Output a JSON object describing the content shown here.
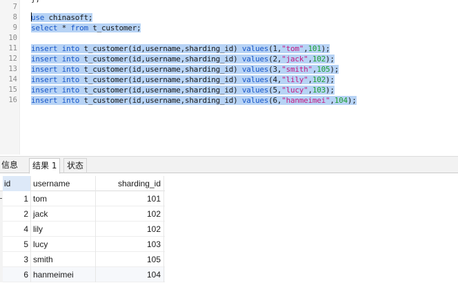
{
  "editor": {
    "top_fragment": "};",
    "lines": [
      {
        "no": "7",
        "tokens": []
      },
      {
        "no": "8",
        "tokens": [
          {
            "t": "kw",
            "v": "use"
          },
          {
            "t": "pl",
            "v": " chinasoft;"
          }
        ],
        "selected": true
      },
      {
        "no": "9",
        "tokens": [
          {
            "t": "kw",
            "v": "select"
          },
          {
            "t": "pl",
            "v": " * "
          },
          {
            "t": "kw",
            "v": "from"
          },
          {
            "t": "pl",
            "v": " t_customer;"
          }
        ],
        "selected": true
      },
      {
        "no": "10",
        "tokens": []
      },
      {
        "no": "11",
        "tokens": [
          {
            "t": "kw",
            "v": "insert into"
          },
          {
            "t": "pl",
            "v": " t_customer(id,username,sharding_id) "
          },
          {
            "t": "kw",
            "v": "values"
          },
          {
            "t": "pl",
            "v": "(1,"
          },
          {
            "t": "str",
            "v": "\"tom\""
          },
          {
            "t": "pl",
            "v": ","
          },
          {
            "t": "num",
            "v": "101"
          },
          {
            "t": "pl",
            "v": ");"
          }
        ],
        "selected": true
      },
      {
        "no": "12",
        "tokens": [
          {
            "t": "kw",
            "v": "insert into"
          },
          {
            "t": "pl",
            "v": " t_customer(id,username,sharding_id) "
          },
          {
            "t": "kw",
            "v": "values"
          },
          {
            "t": "pl",
            "v": "(2,"
          },
          {
            "t": "str",
            "v": "\"jack\""
          },
          {
            "t": "pl",
            "v": ","
          },
          {
            "t": "num",
            "v": "102"
          },
          {
            "t": "pl",
            "v": ");"
          }
        ],
        "selected": true
      },
      {
        "no": "13",
        "tokens": [
          {
            "t": "kw",
            "v": "insert into"
          },
          {
            "t": "pl",
            "v": " t_customer(id,username,sharding_id) "
          },
          {
            "t": "kw",
            "v": "values"
          },
          {
            "t": "pl",
            "v": "(3,"
          },
          {
            "t": "str",
            "v": "\"smith\""
          },
          {
            "t": "pl",
            "v": ","
          },
          {
            "t": "num",
            "v": "105"
          },
          {
            "t": "pl",
            "v": ");"
          }
        ],
        "selected": true
      },
      {
        "no": "14",
        "tokens": [
          {
            "t": "kw",
            "v": "insert into"
          },
          {
            "t": "pl",
            "v": " t_customer(id,username,sharding_id) "
          },
          {
            "t": "kw",
            "v": "values"
          },
          {
            "t": "pl",
            "v": "(4,"
          },
          {
            "t": "str",
            "v": "\"lily\""
          },
          {
            "t": "pl",
            "v": ","
          },
          {
            "t": "num",
            "v": "102"
          },
          {
            "t": "pl",
            "v": ");"
          }
        ],
        "selected": true
      },
      {
        "no": "15",
        "tokens": [
          {
            "t": "kw",
            "v": "insert into"
          },
          {
            "t": "pl",
            "v": " t_customer(id,username,sharding_id) "
          },
          {
            "t": "kw",
            "v": "values"
          },
          {
            "t": "pl",
            "v": "(5,"
          },
          {
            "t": "str",
            "v": "\"lucy\""
          },
          {
            "t": "pl",
            "v": ","
          },
          {
            "t": "num",
            "v": "103"
          },
          {
            "t": "pl",
            "v": ");"
          }
        ],
        "selected": true
      },
      {
        "no": "16",
        "tokens": [
          {
            "t": "kw",
            "v": "insert into"
          },
          {
            "t": "pl",
            "v": " t_customer(id,username,sharding_id) "
          },
          {
            "t": "kw",
            "v": "values"
          },
          {
            "t": "pl",
            "v": "(6,"
          },
          {
            "t": "str",
            "v": "\"hanmeimei\""
          },
          {
            "t": "pl",
            "v": ","
          },
          {
            "t": "num",
            "v": "104"
          },
          {
            "t": "pl",
            "v": ");"
          }
        ],
        "selected": true
      }
    ]
  },
  "tabs": [
    {
      "label": "信息",
      "active": false
    },
    {
      "label": "结果 1",
      "active": true
    },
    {
      "label": "状态",
      "active": false
    }
  ],
  "grid": {
    "columns": [
      "id",
      "username",
      "sharding_id"
    ],
    "rows": [
      [
        "1",
        "tom",
        "101"
      ],
      [
        "2",
        "jack",
        "102"
      ],
      [
        "4",
        "lily",
        "102"
      ],
      [
        "5",
        "lucy",
        "103"
      ],
      [
        "3",
        "smith",
        "105"
      ],
      [
        "6",
        "hanmeimei",
        "104"
      ]
    ]
  },
  "colors": {
    "keyword": "#1a58c9",
    "string": "#c41a82",
    "number": "#1f9f31",
    "selection": "#b7d3f5"
  }
}
